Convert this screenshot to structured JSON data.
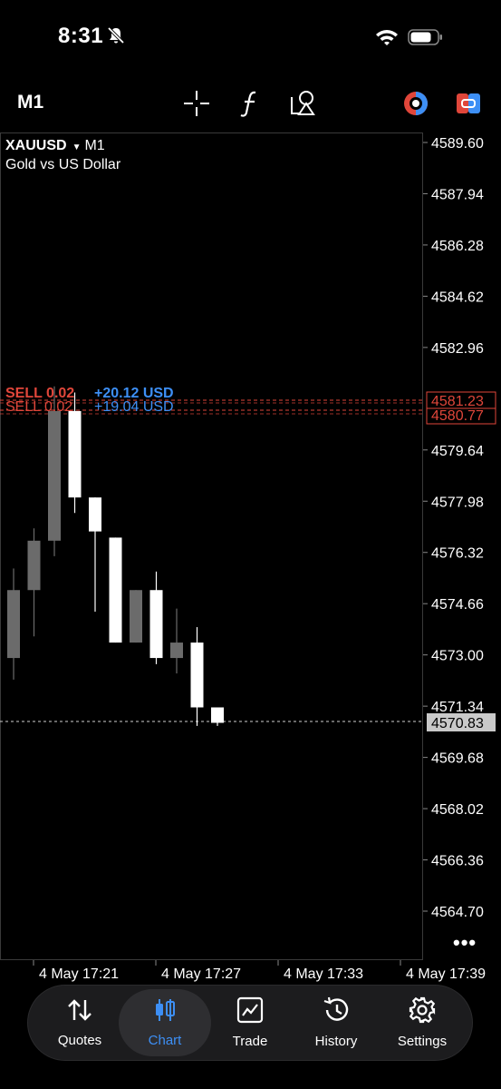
{
  "status_bar": {
    "time": "8:31"
  },
  "toolbar": {
    "timeframe": "M1"
  },
  "symbol": {
    "name": "XAUUSD",
    "timeframe": "M1",
    "description": "Gold vs US Dollar"
  },
  "price_axis": {
    "labels": [
      "4589.60",
      "4587.94",
      "4586.28",
      "4584.62",
      "4582.96",
      "4579.64",
      "4577.98",
      "4576.32",
      "4574.66",
      "4573.00",
      "4571.34",
      "4569.68",
      "4568.02",
      "4566.36",
      "4564.70"
    ],
    "current_price": "4570.83",
    "order_price_1": "4581.23",
    "order_price_2": "4580.77"
  },
  "time_axis": {
    "labels": [
      "4 May 17:21",
      "4 May 17:27",
      "4 May 17:33",
      "4 May 17:39"
    ]
  },
  "orders": [
    {
      "side": "SELL 0.02",
      "profit": "+20.12 USD"
    },
    {
      "side": "SELL 0.02",
      "profit": "+19.04 USD"
    }
  ],
  "colors": {
    "accent": "#3d8ff5",
    "sell": "#e0463a",
    "bull_candle": "#ffffff",
    "bear_candle": "#6b6b6b"
  },
  "chart_data": {
    "type": "candlestick",
    "symbol": "XAUUSD",
    "timeframe": "M1",
    "ylim": [
      4563.9,
      4590.3
    ],
    "x": [
      "4 May 17:19",
      "4 May 17:20",
      "4 May 17:21",
      "4 May 17:22",
      "4 May 17:23",
      "4 May 17:24",
      "4 May 17:25",
      "4 May 17:26",
      "4 May 17:27",
      "4 May 17:28",
      "4 May 17:29"
    ],
    "candles": [
      {
        "o": 4572.9,
        "h": 4575.8,
        "l": 4572.2,
        "c": 4575.1
      },
      {
        "o": 4575.1,
        "h": 4577.1,
        "l": 4573.6,
        "c": 4576.7
      },
      {
        "o": 4576.7,
        "h": 4581.7,
        "l": 4576.2,
        "c": 4580.9
      },
      {
        "o": 4580.9,
        "h": 4581.5,
        "l": 4577.6,
        "c": 4578.1
      },
      {
        "o": 4578.1,
        "h": 4578.1,
        "l": 4574.4,
        "c": 4577.0
      },
      {
        "o": 4576.8,
        "h": 4576.8,
        "l": 4573.4,
        "c": 4573.4
      },
      {
        "o": 4573.4,
        "h": 4575.1,
        "l": 4573.4,
        "c": 4575.1
      },
      {
        "o": 4575.1,
        "h": 4575.7,
        "l": 4572.7,
        "c": 4572.9
      },
      {
        "o": 4572.9,
        "h": 4574.5,
        "l": 4572.4,
        "c": 4573.4
      },
      {
        "o": 4573.4,
        "h": 4573.9,
        "l": 4570.7,
        "c": 4571.3
      },
      {
        "o": 4571.3,
        "h": 4571.3,
        "l": 4570.7,
        "c": 4570.8
      }
    ]
  },
  "nav": {
    "items": [
      {
        "label": "Quotes"
      },
      {
        "label": "Chart"
      },
      {
        "label": "Trade"
      },
      {
        "label": "History"
      },
      {
        "label": "Settings"
      }
    ]
  }
}
